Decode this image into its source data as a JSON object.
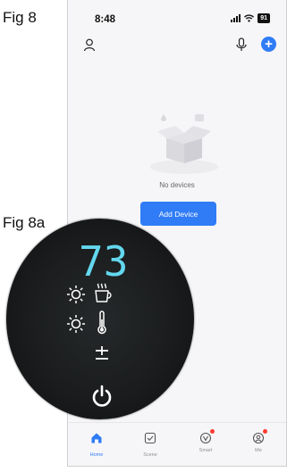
{
  "figure_labels": {
    "fig8": "Fig 8",
    "fig8a": "Fig 8a"
  },
  "status_bar": {
    "time": "8:48",
    "battery": "91"
  },
  "empty_state": {
    "message": "No devices",
    "add_button": "Add Device"
  },
  "tabbar": {
    "tabs": [
      {
        "label": "Home",
        "icon": "home-icon",
        "active": true
      },
      {
        "label": "Scene",
        "icon": "scene-icon",
        "active": false
      },
      {
        "label": "Smart",
        "icon": "smart-icon",
        "active": false
      },
      {
        "label": "Me",
        "icon": "me-icon",
        "active": false
      }
    ]
  },
  "device_panel": {
    "temperature": "73",
    "accent_color": "#63d7ee",
    "icons": [
      "sun-icon",
      "coffee-cup-icon",
      "sun-icon",
      "thermometer-icon",
      "plus-minus-icon",
      "power-icon"
    ]
  },
  "colors": {
    "primary": "#2f7cf6",
    "background": "#f6f6f8",
    "badge": "#ff3b30"
  }
}
